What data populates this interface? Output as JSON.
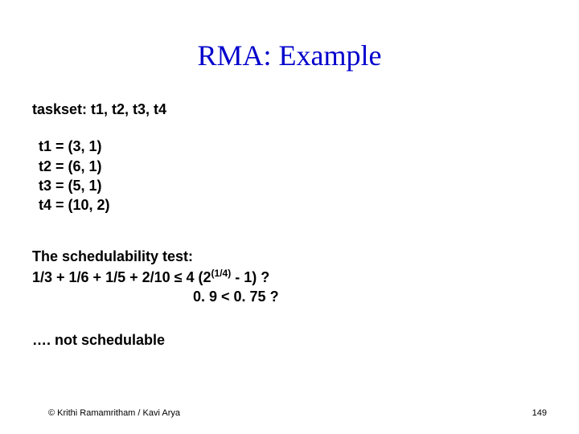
{
  "title": "RMA: Example",
  "taskset_label": "taskset:  t1, t2, t3, t4",
  "tasks": {
    "t1": "t1 = (3, 1)",
    "t2": "t2 = (6, 1)",
    "t3": "t3 = (5, 1)",
    "t4": "t4 = (10, 2)"
  },
  "sched": {
    "heading": "The schedulability test:",
    "line2_pre": "1/3 + 1/6 + 1/5 + 2/10   ≤  4  (2",
    "line2_exp": "(1/4)",
    "line2_post": " - 1) ?",
    "line3": "0. 9  <   0. 75 ?"
  },
  "conclusion": "…. not schedulable",
  "footer": "© Krithi Ramamritham / Kavi Arya",
  "page_number": "149"
}
